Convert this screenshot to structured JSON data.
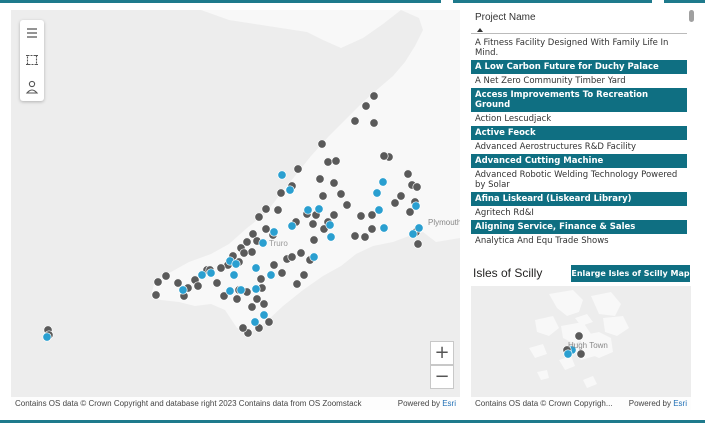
{
  "map": {
    "place_label": "Plymouth",
    "town_label": "Truro",
    "attribution": "Contains OS data © Crown Copyright and database right 2023 Contains data from OS Zoomstack",
    "powered_by": "Powered by",
    "esri": "Esri",
    "zoom_in": "+",
    "zoom_out": "−",
    "colors": {
      "land": "#f8f8f8",
      "sea": "#ededed",
      "point_grey": "#5a5a5a",
      "point_blue": "#2a9fd0"
    },
    "tools": [
      {
        "icon": "hamburger-menu-icon"
      },
      {
        "icon": "rectangle-select-icon"
      },
      {
        "icon": "person-select-icon"
      }
    ]
  },
  "list": {
    "header": "Project Name",
    "items": [
      {
        "label": "A Fitness Facility Designed With Family Life In Mind.",
        "selected": false
      },
      {
        "label": "A Low Carbon Future for Duchy Palace",
        "selected": true
      },
      {
        "label": "A Net Zero Community Timber Yard",
        "selected": false
      },
      {
        "label": "Access Improvements To Recreation Ground",
        "selected": true
      },
      {
        "label": "Action Lescudjack",
        "selected": false
      },
      {
        "label": "Active Feock",
        "selected": true
      },
      {
        "label": "Advanced Aerostructures R&D Facility",
        "selected": false
      },
      {
        "label": "Advanced Cutting Machine",
        "selected": true
      },
      {
        "label": "Advanced Robotic Welding Technology Powered by Solar",
        "selected": false
      },
      {
        "label": "Afina Liskeard (Liskeard Library)",
        "selected": true
      },
      {
        "label": "Agritech Rd&I",
        "selected": false
      },
      {
        "label": "Aligning Service, Finance & Sales",
        "selected": true
      },
      {
        "label": "Analytica And Equ Trade Shows",
        "selected": false
      }
    ]
  },
  "scilly": {
    "title": "Isles of Scilly",
    "enlarge_label": "Enlarge Isles of Scilly Map",
    "place_label": "Hugh Town",
    "attribution": "Contains OS data © Crown Copyrigh...",
    "powered_by": "Powered by",
    "esri": "Esri"
  }
}
